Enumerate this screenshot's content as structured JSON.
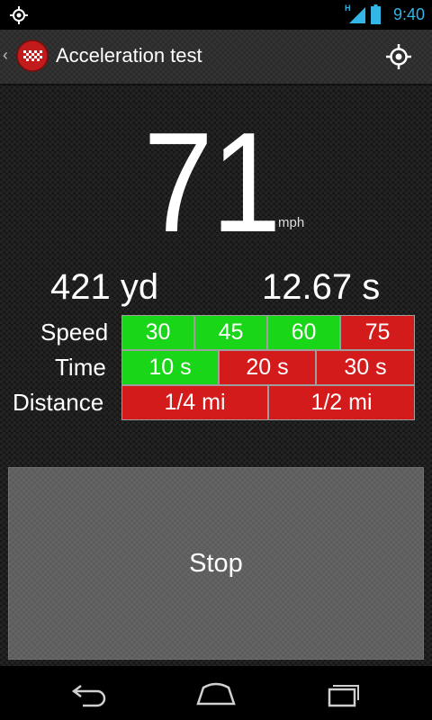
{
  "status_bar": {
    "network_type": "H",
    "time": "9:40",
    "icons": [
      "gps-icon",
      "signal-icon",
      "battery-icon"
    ]
  },
  "action_bar": {
    "title": "Acceleration test",
    "icons": [
      "app-icon",
      "locate-icon"
    ]
  },
  "readout": {
    "speed": "71",
    "unit": "mph",
    "distance": "421 yd",
    "time": "12.67 s"
  },
  "grid": {
    "speed": {
      "label": "Speed",
      "cells": [
        {
          "text": "30",
          "status": "ok"
        },
        {
          "text": "45",
          "status": "ok"
        },
        {
          "text": "60",
          "status": "ok"
        },
        {
          "text": "75",
          "status": "fail"
        }
      ]
    },
    "time": {
      "label": "Time",
      "cells": [
        {
          "text": "10 s",
          "status": "ok"
        },
        {
          "text": "20 s",
          "status": "fail"
        },
        {
          "text": "30 s",
          "status": "fail"
        }
      ]
    },
    "distance": {
      "label": "Distance",
      "cells": [
        {
          "text": "1/4 mi",
          "status": "fail"
        },
        {
          "text": "1/2 mi",
          "status": "fail"
        }
      ]
    }
  },
  "stop_button": {
    "label": "Stop"
  },
  "nav_bar": {
    "icons": [
      "back-icon",
      "home-icon",
      "recents-icon"
    ]
  },
  "colors": {
    "accent": "#33b5e5",
    "ok": "#19d619",
    "fail": "#d41b1b",
    "button": "#5c5c5c"
  }
}
